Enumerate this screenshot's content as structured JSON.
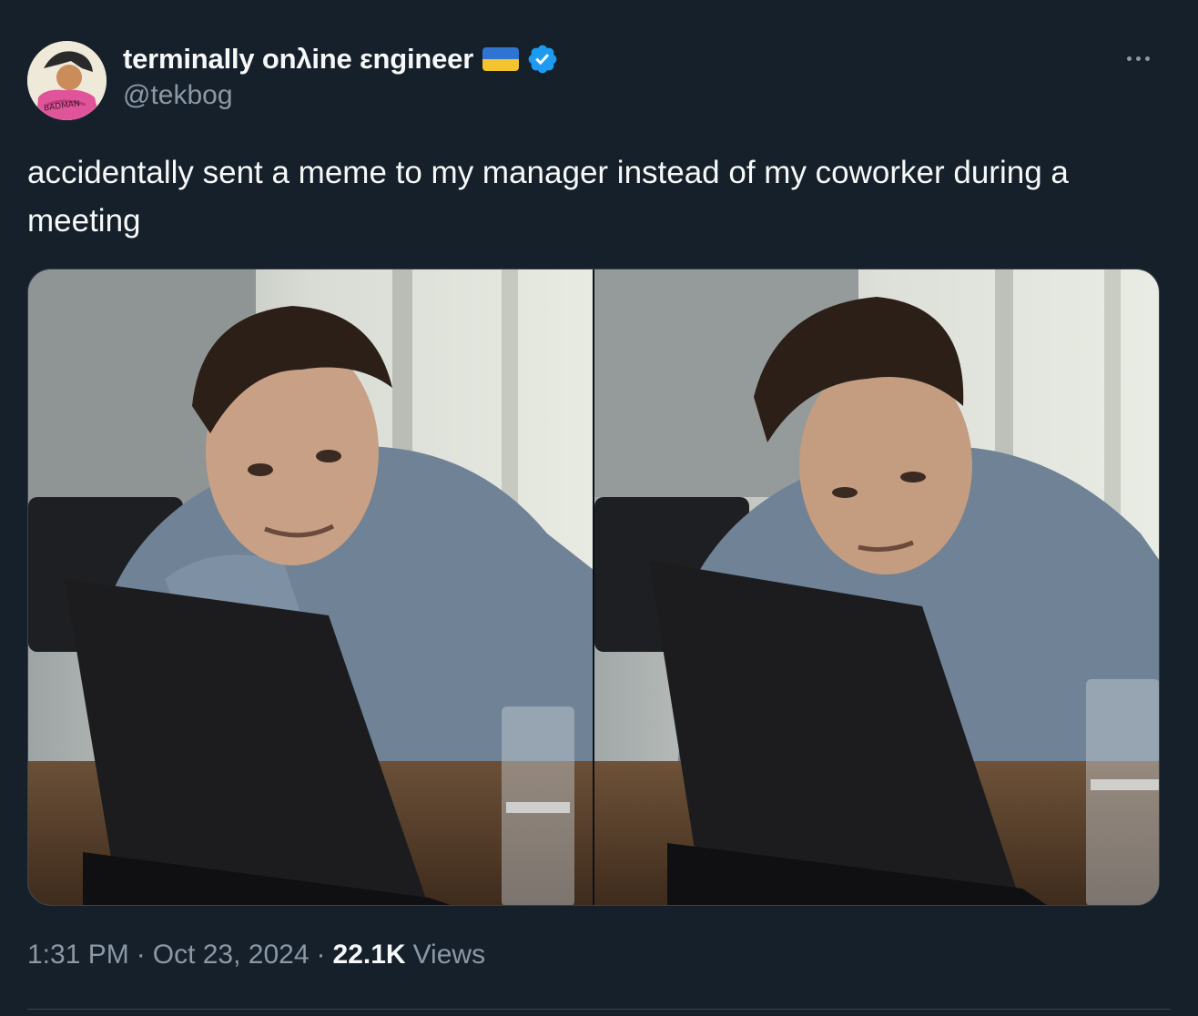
{
  "author": {
    "display_name": "terminally onλine εngineer",
    "handle": "@tekbog",
    "avatar_icon": "avatar-anime-character",
    "avatar_text": "BADMAN",
    "flag_icon": "ukraine-flag-icon",
    "verified_icon": "verified-badge-icon",
    "verified_color": "#1d9bf0"
  },
  "more_icon": "more-options-icon",
  "tweet": {
    "text": "accidentally sent a meme to my manager instead of my coworker during a meeting"
  },
  "media": {
    "panels": [
      {
        "description_icon": "meme-frame-left"
      },
      {
        "description_icon": "meme-frame-right"
      }
    ]
  },
  "meta": {
    "time": "1:31 PM",
    "separator": "·",
    "date": "Oct 23, 2024",
    "views_count": "22.1K",
    "views_label": "Views"
  },
  "colors": {
    "background": "#15202b",
    "primary_text": "#f7f9f9",
    "secondary_text": "#8b98a5",
    "border": "#38444d"
  }
}
